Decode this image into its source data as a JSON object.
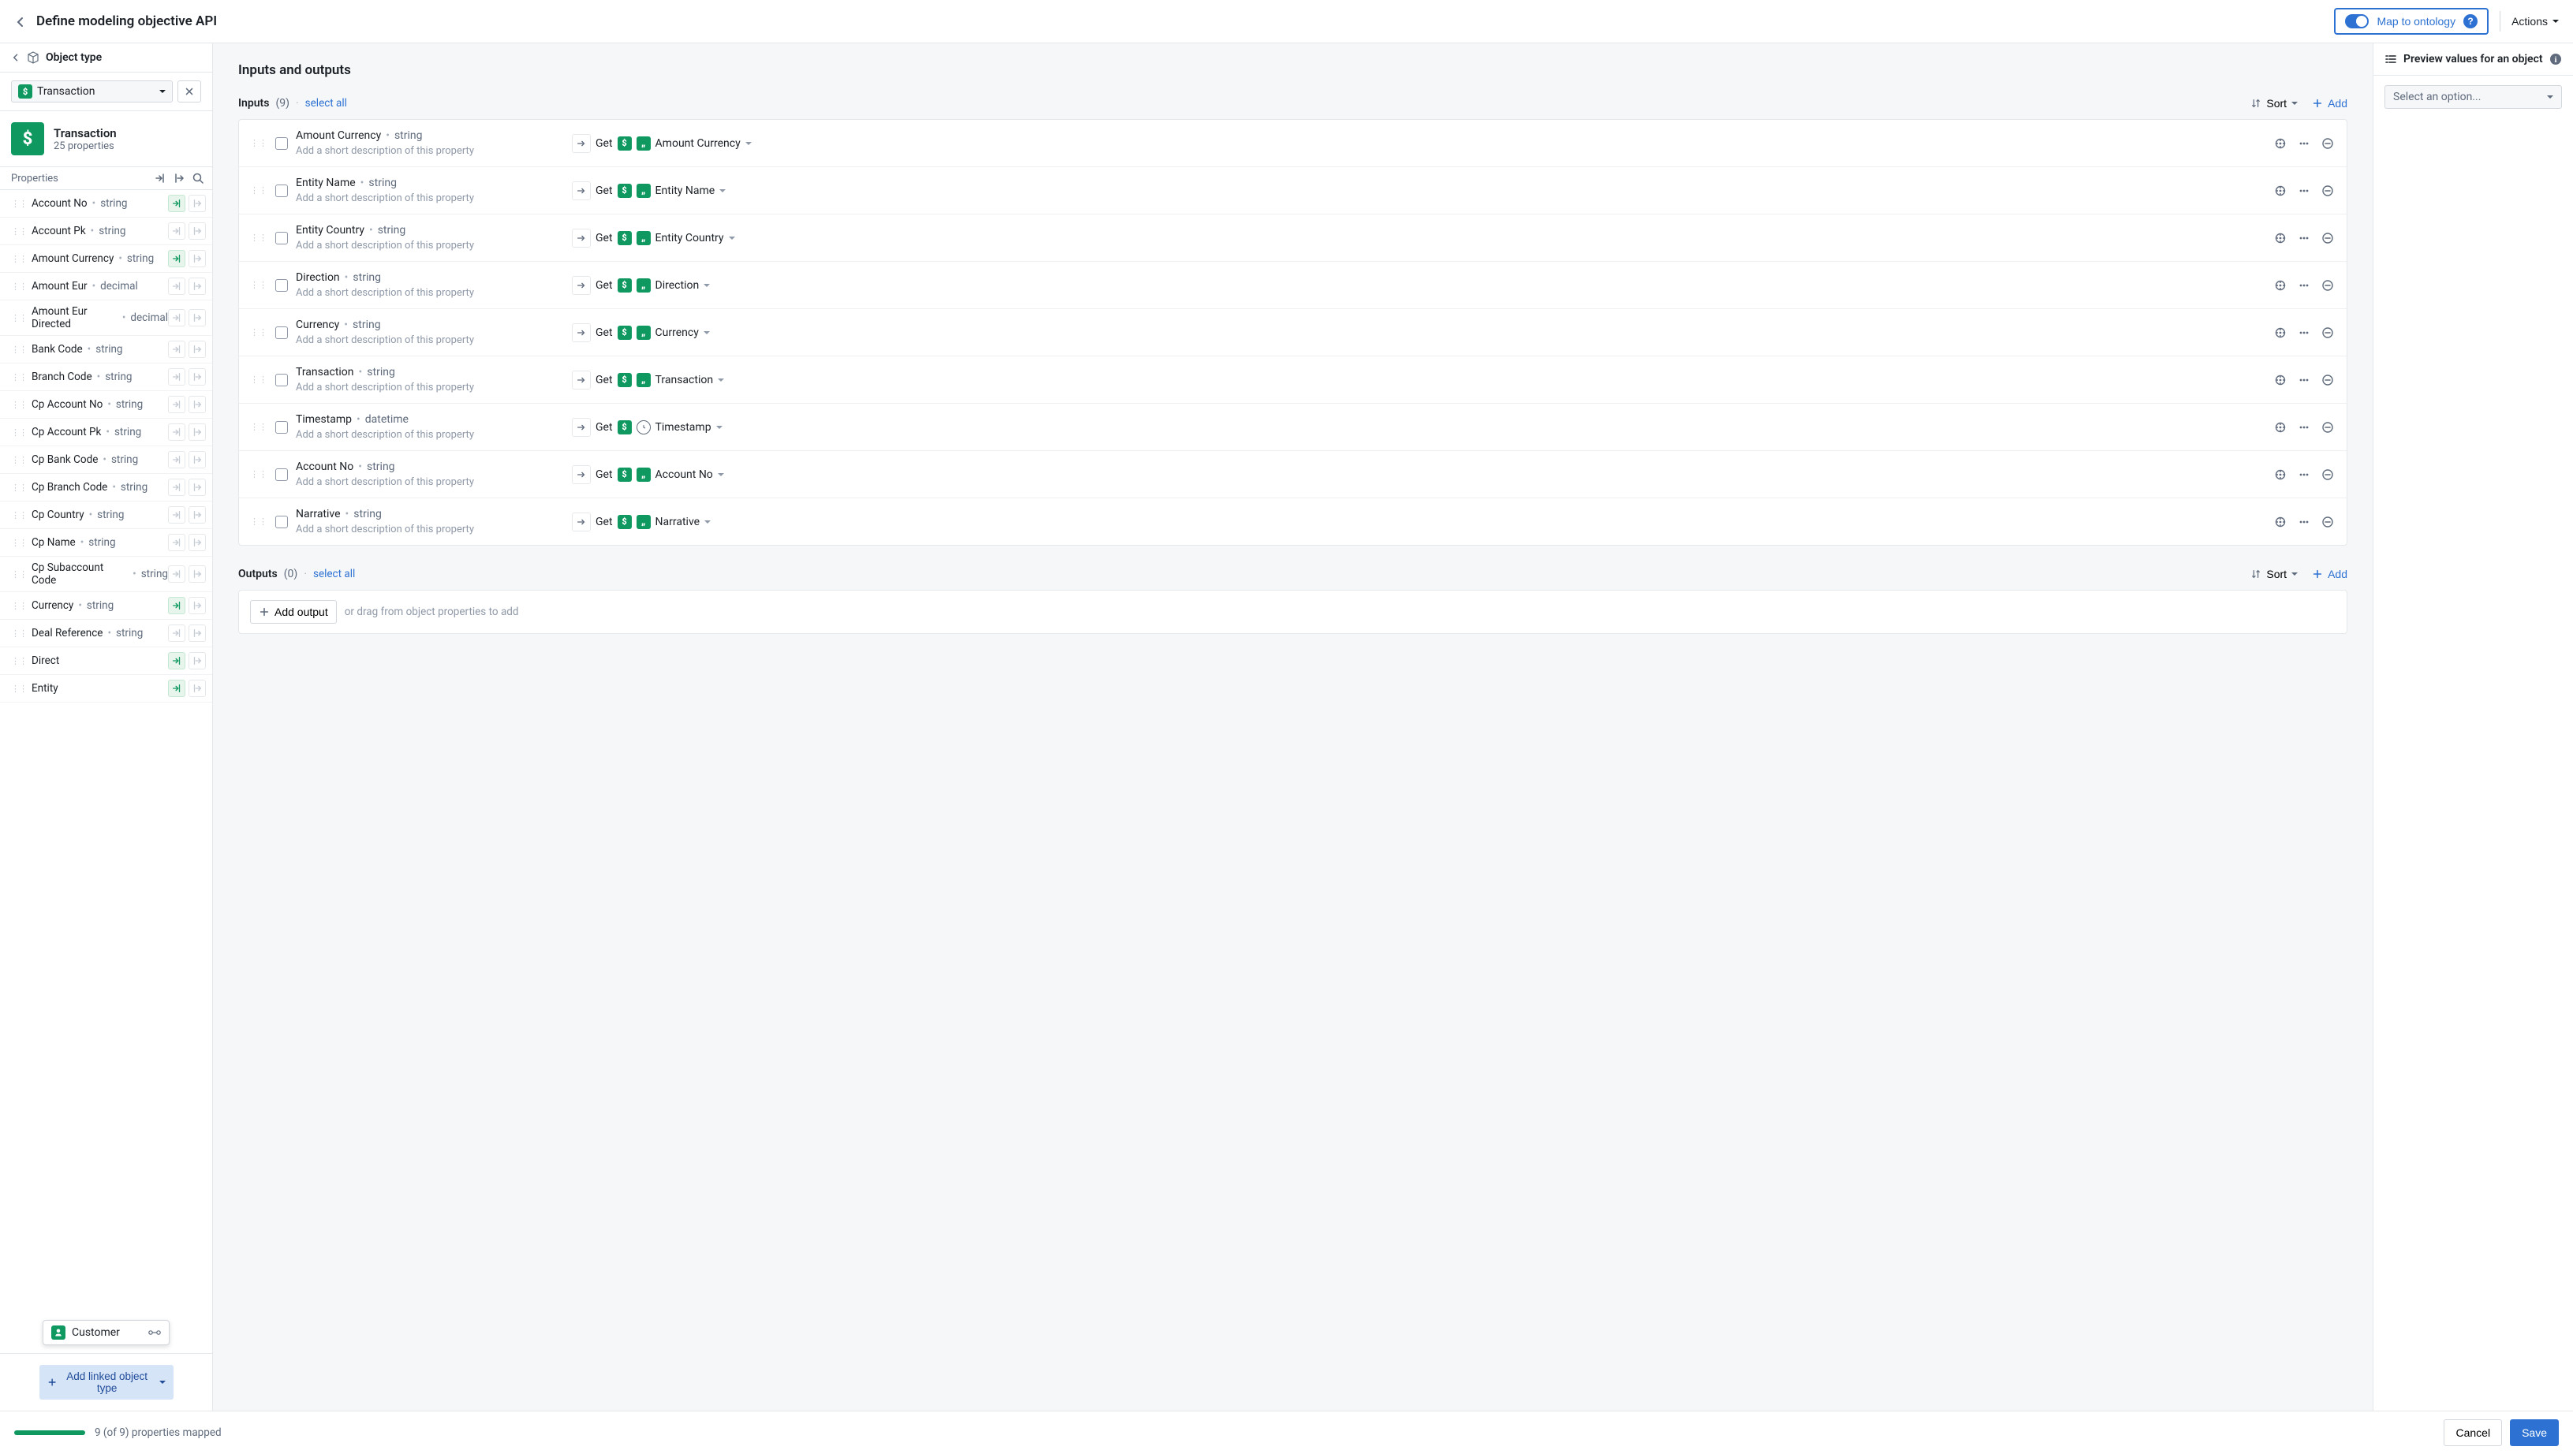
{
  "header": {
    "title": "Define modeling objective API",
    "map_label": "Map to ontology",
    "actions_label": "Actions"
  },
  "sidebar": {
    "section_label": "Object type",
    "select_value": "Transaction",
    "object": {
      "name": "Transaction",
      "subtitle": "25 properties"
    },
    "properties_label": "Properties",
    "properties": [
      {
        "name": "Account No",
        "type": "string",
        "input_active": true
      },
      {
        "name": "Account Pk",
        "type": "string",
        "input_active": false
      },
      {
        "name": "Amount Currency",
        "type": "string",
        "input_active": true
      },
      {
        "name": "Amount Eur",
        "type": "decimal",
        "input_active": false
      },
      {
        "name": "Amount Eur Directed",
        "type": "decimal",
        "input_active": false
      },
      {
        "name": "Bank Code",
        "type": "string",
        "input_active": false
      },
      {
        "name": "Branch Code",
        "type": "string",
        "input_active": false
      },
      {
        "name": "Cp Account No",
        "type": "string",
        "input_active": false
      },
      {
        "name": "Cp Account Pk",
        "type": "string",
        "input_active": false
      },
      {
        "name": "Cp Bank Code",
        "type": "string",
        "input_active": false
      },
      {
        "name": "Cp Branch Code",
        "type": "string",
        "input_active": false
      },
      {
        "name": "Cp Country",
        "type": "string",
        "input_active": false
      },
      {
        "name": "Cp Name",
        "type": "string",
        "input_active": false
      },
      {
        "name": "Cp Subaccount Code",
        "type": "string",
        "input_active": false
      },
      {
        "name": "Currency",
        "type": "string",
        "input_active": true
      },
      {
        "name": "Deal Reference",
        "type": "string",
        "input_active": false
      },
      {
        "name": "Direct",
        "type": "",
        "input_active": true
      },
      {
        "name": "Entity",
        "type": "",
        "input_active": true
      }
    ],
    "customer_popup": "Customer",
    "add_linked_label": "Add linked object type"
  },
  "main": {
    "heading": "Inputs and outputs",
    "inputs_label": "Inputs",
    "inputs_count": "(9)",
    "select_all": "select all",
    "sort_label": "Sort",
    "add_label": "Add",
    "desc_placeholder": "Add a short description of this property",
    "get_label": "Get",
    "inputs": [
      {
        "name": "Amount Currency",
        "type": "string",
        "get": "Amount Currency",
        "icon": "quote"
      },
      {
        "name": "Entity Name",
        "type": "string",
        "get": "Entity Name",
        "icon": "quote"
      },
      {
        "name": "Entity Country",
        "type": "string",
        "get": "Entity Country",
        "icon": "quote"
      },
      {
        "name": "Direction",
        "type": "string",
        "get": "Direction",
        "icon": "quote"
      },
      {
        "name": "Currency",
        "type": "string",
        "get": "Currency",
        "icon": "quote"
      },
      {
        "name": "Transaction",
        "type": "string",
        "get": "Transaction",
        "icon": "quote"
      },
      {
        "name": "Timestamp",
        "type": "datetime",
        "get": "Timestamp",
        "icon": "clock"
      },
      {
        "name": "Account No",
        "type": "string",
        "get": "Account No",
        "icon": "quote"
      },
      {
        "name": "Narrative",
        "type": "string",
        "get": "Narrative",
        "icon": "quote"
      }
    ],
    "outputs_label": "Outputs",
    "outputs_count": "(0)",
    "add_output_label": "Add output",
    "drag_hint": "or drag from object properties to add"
  },
  "rightbar": {
    "heading": "Preview values for an object",
    "select_placeholder": "Select an option..."
  },
  "footer": {
    "status": "9 (of 9) properties mapped",
    "cancel": "Cancel",
    "save": "Save"
  }
}
